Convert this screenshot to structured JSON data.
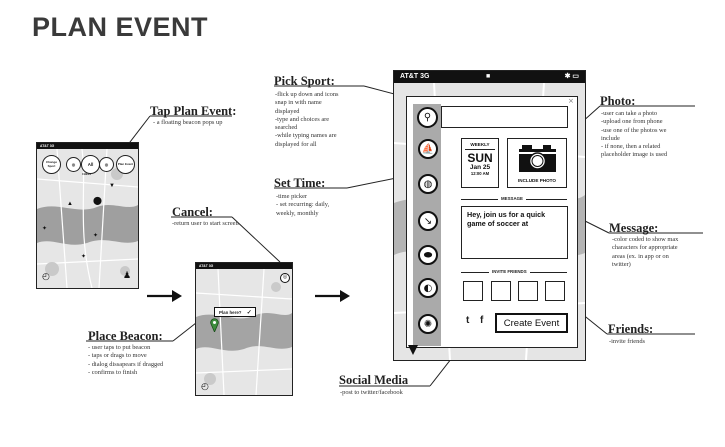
{
  "title": "PLAN EVENT",
  "sections": {
    "tap_plan_event": {
      "heading": "Tap Plan Event:",
      "notes": [
        "- a floating beacon pops up"
      ]
    },
    "cancel": {
      "heading": "Cancel:",
      "notes": [
        "-return user to start screen"
      ]
    },
    "place_beacon": {
      "heading": "Place Beacon:",
      "notes": [
        "- user taps to put beacon",
        "- taps or drags to move",
        "- dialog dissapears if dragged",
        "- confirms to finish"
      ]
    },
    "pick_sport": {
      "heading": "Pick Sport:",
      "notes": [
        "-flick up down and icons",
        "snap in with name",
        "displayed",
        "-type and choices are",
        "searched",
        "-while typing names are",
        "displayed for all"
      ]
    },
    "set_time": {
      "heading": "Set Time:",
      "notes": [
        "-time picker",
        "- set recurring: daily,",
        "weekly, monthly"
      ]
    },
    "social_media": {
      "heading": "Social Media",
      "notes": [
        "-post to twitter/facebook"
      ]
    },
    "photo": {
      "heading": "Photo:",
      "notes": [
        "-user can take a photo",
        "-upload one from phone",
        "-use one of the photos we",
        "include",
        "- if none, then a related",
        "placeholder image is used"
      ]
    },
    "message": {
      "heading": "Message:",
      "notes": [
        "-color coded to show max",
        "characters for appropriate",
        "areas (ex. in app or on",
        "twitter)"
      ]
    },
    "friends": {
      "heading": "Friends:",
      "notes": [
        "-invite friends"
      ]
    }
  },
  "phone1": {
    "carrier": "AT&T 3G",
    "pills": [
      "Change Sport",
      "All",
      "Plan Event"
    ],
    "sub_label": "CHESS"
  },
  "phone2": {
    "carrier": "AT&T 3G",
    "dialog": "Plan here?",
    "check": "✓"
  },
  "phone3": {
    "carrier": "AT&T 3G",
    "close": "×",
    "time": {
      "recurring": "WEEKLY",
      "day": "SUN",
      "date": "Jan 25",
      "clock": "12:00 AM"
    },
    "photo_label": "INCLUDE PHOTO",
    "message_label": "MESSAGE",
    "message_text": "Hey, join us for a quick game of soccer at",
    "friends_label": "INVITE FRIENDS",
    "twitter": "t",
    "facebook": "f",
    "create_button": "Create Event"
  },
  "icons": {
    "search": "search-icon",
    "sports": [
      "kayak-icon",
      "tennis-racket-icon",
      "hockey-stick-icon",
      "football-icon",
      "baseball-icon",
      "soccer-ball-icon"
    ]
  }
}
